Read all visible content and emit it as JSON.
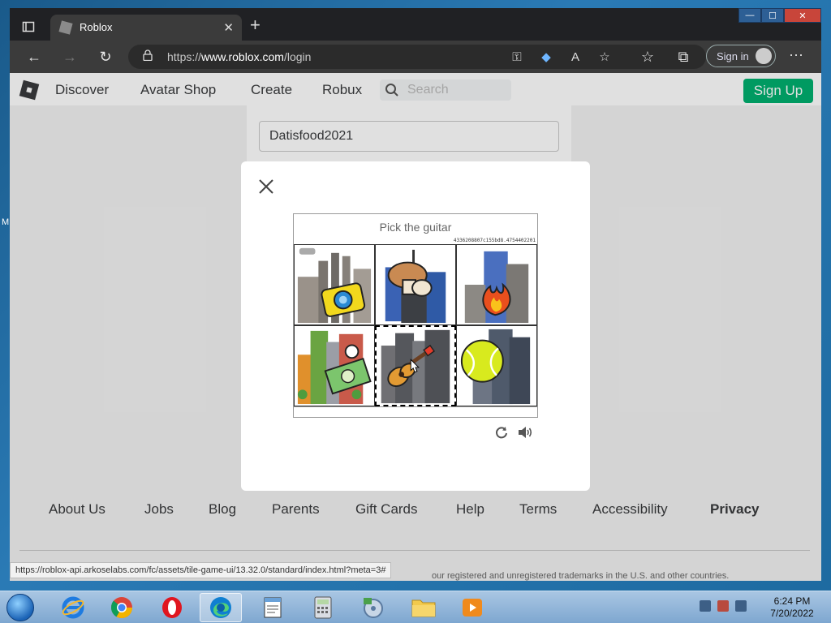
{
  "desktop": {
    "edge_text": "M"
  },
  "browser": {
    "tab": {
      "title": "Roblox",
      "close": "✕"
    },
    "new_tab": "+",
    "window_controls": {
      "minimize": "—",
      "maximize": "☐",
      "close": "✕"
    },
    "toolbar": {
      "back": "←",
      "forward": "→",
      "refresh": "↻",
      "url_prefix": "https://",
      "url_domain": "www.roblox.com",
      "url_path": "/login",
      "signin_label": "Sign in",
      "menu": "⋯"
    },
    "status_url": "https://roblox-api.arkoselabs.com/fc/assets/tile-game-ui/13.32.0/standard/index.html?meta=3#"
  },
  "roblox": {
    "nav": {
      "discover": "Discover",
      "avatar_shop": "Avatar Shop",
      "create": "Create",
      "robux": "Robux",
      "search_placeholder": "Search",
      "signup": "Sign Up"
    },
    "login": {
      "username_value": "Datisfood2021"
    },
    "footer": {
      "links": [
        "About Us",
        "Jobs",
        "Blog",
        "Parents",
        "Gift Cards",
        "Help",
        "Terms",
        "Accessibility",
        "Privacy"
      ],
      "legal": "our registered and unregistered trademarks in the U.S. and other countries."
    }
  },
  "captcha": {
    "prompt": "Pick the guitar",
    "hash": "4336208807c155bd8.4754402201",
    "tiles": [
      "factory-camera",
      "building-mushroom",
      "building-fire",
      "city-money",
      "city-guitar",
      "building-tennis-ball"
    ],
    "selected_tile": 4
  },
  "taskbar": {
    "apps": [
      "internet-explorer",
      "chrome",
      "opera",
      "edge",
      "notepad",
      "calculator",
      "media-center",
      "file-explorer",
      "media-player"
    ],
    "active_app": "edge",
    "clock_time": "6:24 PM",
    "clock_date": "7/20/2022"
  },
  "colors": {
    "signup_green": "#00b06f",
    "browser_dark": "#202124",
    "taskbar": "#7ea7d0"
  }
}
